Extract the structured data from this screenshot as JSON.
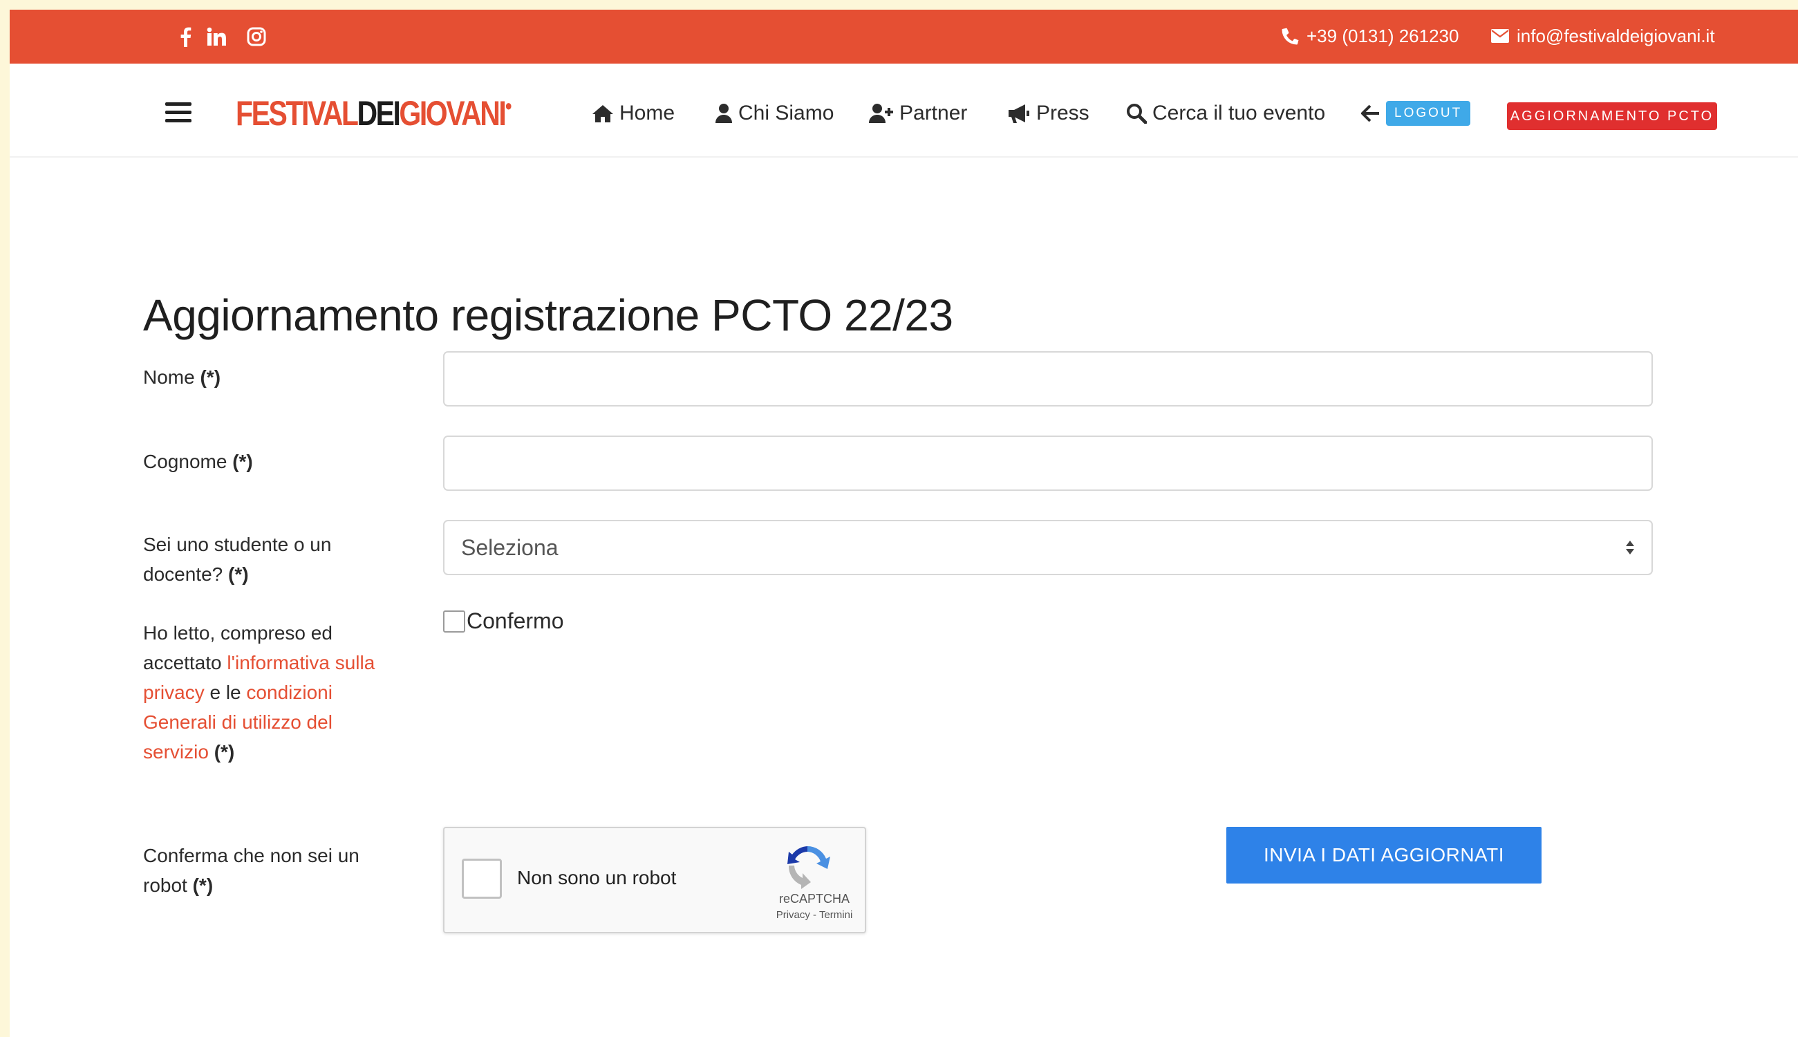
{
  "topbar": {
    "social": [
      {
        "icon": "facebook-icon"
      },
      {
        "icon": "linkedin-icon"
      },
      {
        "icon": "instagram-icon"
      }
    ],
    "phone": "+39 (0131) 261230",
    "email": "info@festivaldeigiovani.it",
    "color": "#e54f33"
  },
  "nav": {
    "logo": {
      "part1": "FESTIVAL",
      "part2": "DEI",
      "part3": "GIOVANI"
    },
    "items": [
      {
        "label": "Home",
        "icon": "home-icon"
      },
      {
        "label": "Chi Siamo",
        "icon": "user-icon"
      },
      {
        "label": "Partner",
        "icon": "user-plus-icon"
      },
      {
        "label": "Press",
        "icon": "megaphone-icon"
      },
      {
        "label": "Cerca il tuo evento",
        "icon": "search-icon"
      }
    ],
    "logout_label": "LOGOUT",
    "pcto_button": "AGGIORNAMENTO PCTO"
  },
  "form": {
    "title": "Aggiornamento registrazione PCTO 22/23",
    "required_mark": "(*)",
    "nome_label": "Nome",
    "nome_value": "",
    "cognome_label": "Cognome",
    "cognome_value": "",
    "role_label_1": "Sei uno studente o un",
    "role_label_2": "docente?",
    "role_selected": "Seleziona",
    "privacy": {
      "line1": "Ho letto, compreso ed",
      "accepted": "accettato",
      "link1_a": "l'informativa sulla",
      "link1_b": "privacy",
      "and": "e le",
      "link2_a": "condizioni",
      "link2_b": "Generali di utilizzo del",
      "link2_c": "servizio"
    },
    "confirm_label": "Confermo",
    "robot_label_1": "Conferma che non sei un",
    "robot_label_2": "robot",
    "submit_label": "INVIA I DATI AGGIORNATI"
  },
  "recaptcha": {
    "text": "Non sono un robot",
    "brand": "reCAPTCHA",
    "privacy": "Privacy",
    "separator": " - ",
    "terms": "Termini"
  }
}
